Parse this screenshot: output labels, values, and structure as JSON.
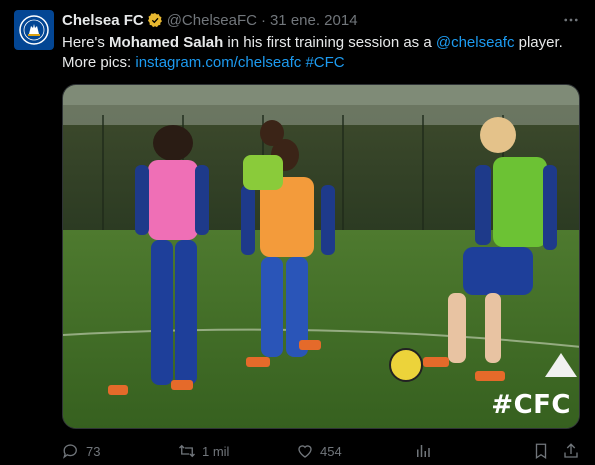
{
  "tweet": {
    "author_name": "Chelsea FC",
    "handle": "@ChelseaFC",
    "separator": "·",
    "date": "31 ene. 2014",
    "text_part1": "Here's ",
    "text_bold": "Mohamed Salah",
    "text_part2": " in his first training session as a ",
    "mention": "@chelseafc",
    "text_part3": " player.",
    "text_line2_prefix": "More pics: ",
    "link": "instagram.com/chelseafc",
    "hashtag": "#CFC",
    "image_overlay_text": "#CFC",
    "avatar_text": "CHELSEA FOOTBALL CLUB"
  },
  "actions": {
    "replies": "73",
    "reposts": "1 mil",
    "likes": "454"
  },
  "colors": {
    "background": "#000000",
    "link": "#1d9bf0",
    "verified": "#e8b830",
    "avatar_bg": "#034694",
    "muted": "#71767b"
  },
  "icons": [
    "chelsea-crest-icon",
    "verified-badge-icon",
    "more-options-icon",
    "reply-icon",
    "repost-icon",
    "like-icon",
    "views-icon",
    "bookmark-icon",
    "share-icon"
  ]
}
